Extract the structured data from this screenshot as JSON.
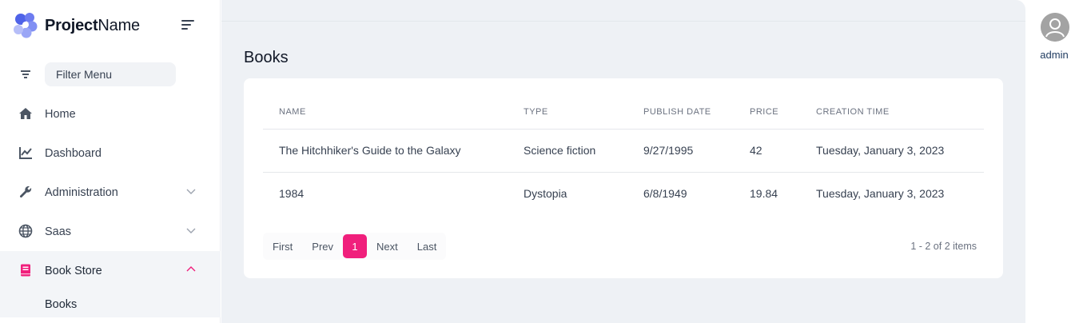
{
  "brand": {
    "name_bold": "Project",
    "name_rest": "Name"
  },
  "sidebar": {
    "filter_placeholder": "Filter Menu",
    "items": [
      {
        "label": "Home",
        "icon": "home-icon"
      },
      {
        "label": "Dashboard",
        "icon": "chart-line-icon"
      },
      {
        "label": "Administration",
        "icon": "wrench-icon",
        "expandable": true
      },
      {
        "label": "Saas",
        "icon": "globe-icon",
        "expandable": true
      },
      {
        "label": "Book Store",
        "icon": "book-icon",
        "expanded": true,
        "active": true
      }
    ],
    "subitems": [
      {
        "label": "Books"
      }
    ]
  },
  "page": {
    "title": "Books"
  },
  "table": {
    "headers": [
      "NAME",
      "TYPE",
      "PUBLISH DATE",
      "PRICE",
      "CREATION TIME"
    ],
    "rows": [
      [
        "The Hitchhiker's Guide to the Galaxy",
        "Science fiction",
        "9/27/1995",
        "42",
        "Tuesday, January 3, 2023"
      ],
      [
        "1984",
        "Dystopia",
        "6/8/1949",
        "19.84",
        "Tuesday, January 3, 2023"
      ]
    ]
  },
  "pager": {
    "first": "First",
    "prev": "Prev",
    "current": "1",
    "next": "Next",
    "last": "Last",
    "info": "1 - 2 of 2 items"
  },
  "user": {
    "name": "admin"
  },
  "colors": {
    "accent": "#f01f7c",
    "brand_blue": "#5b6cf0",
    "background": "#eef1f5"
  }
}
